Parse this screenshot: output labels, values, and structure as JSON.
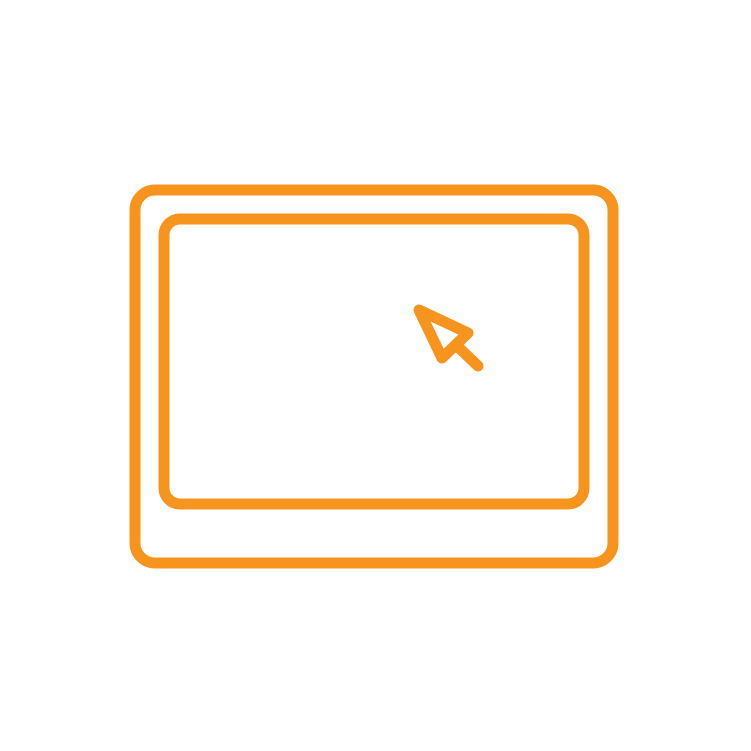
{
  "icon": {
    "name": "tablet-with-cursor-icon",
    "parts": {
      "outer_frame": "tablet-frame",
      "inner_screen": "tablet-screen",
      "cursor": "cursor-arrow-icon"
    }
  },
  "colors": {
    "stroke": "#F7941D",
    "background": "#FFFFFF"
  }
}
